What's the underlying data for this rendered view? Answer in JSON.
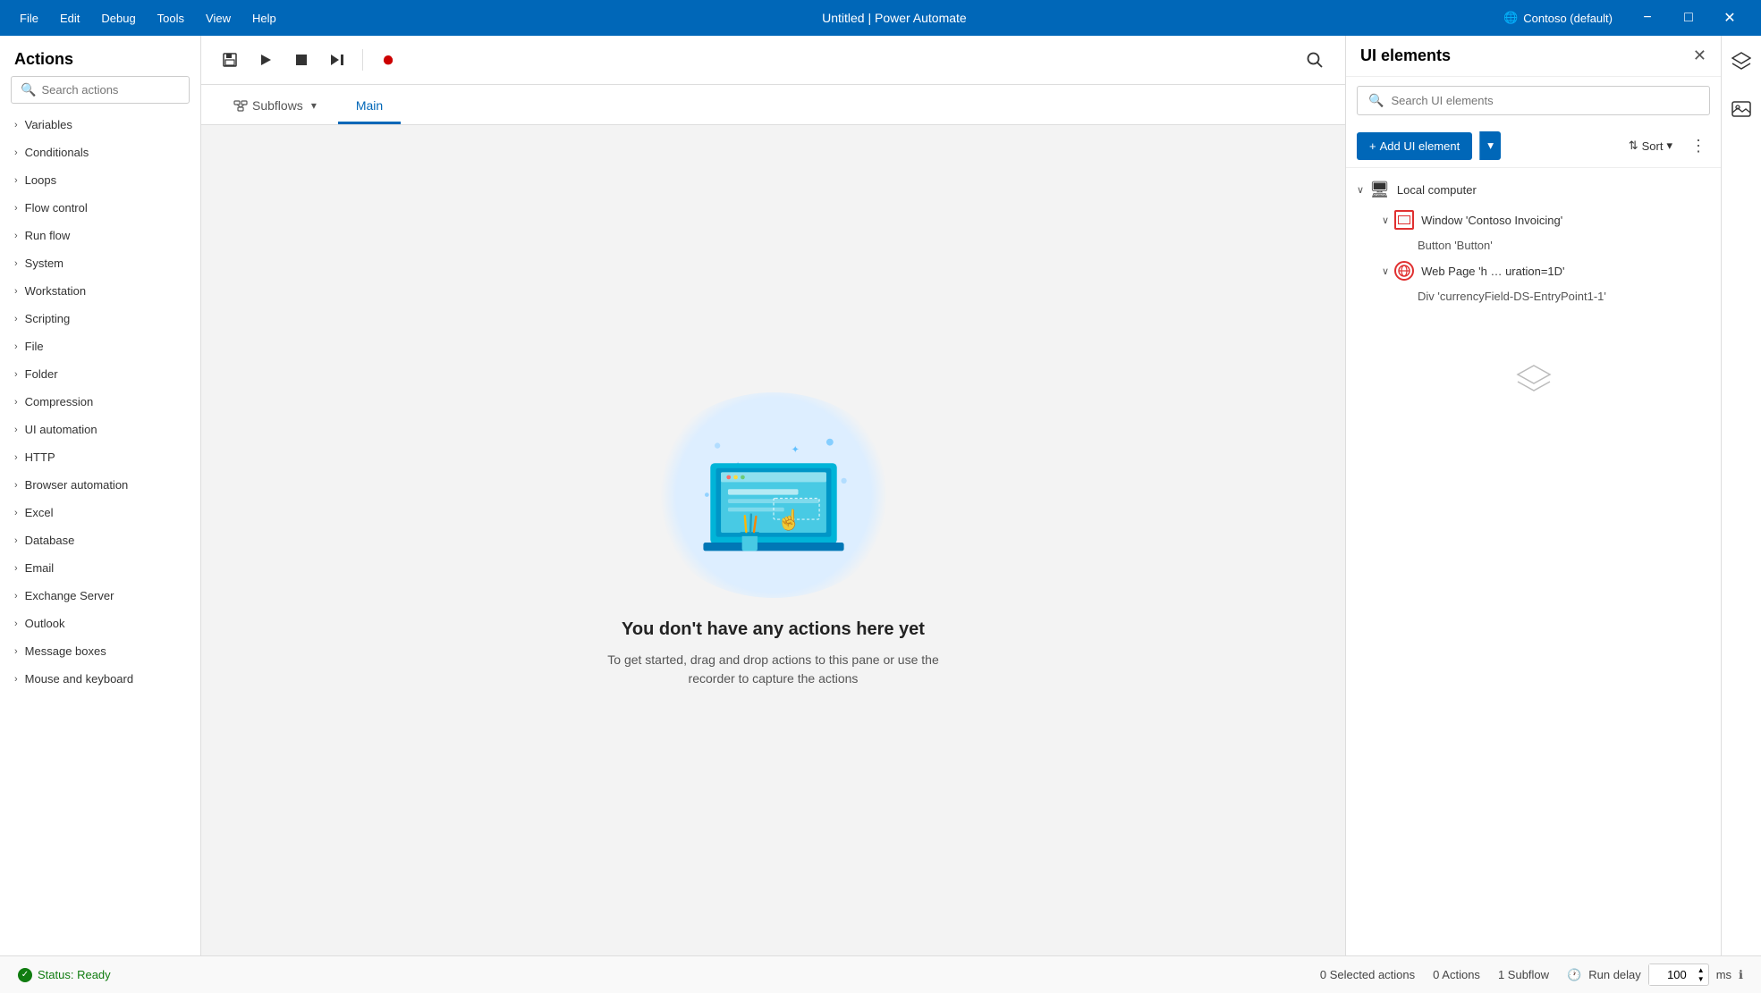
{
  "titlebar": {
    "menus": [
      "File",
      "Edit",
      "Debug",
      "Tools",
      "View",
      "Help"
    ],
    "title": "Untitled | Power Automate",
    "user": "Contoso (default)",
    "window_controls": [
      "−",
      "□",
      "✕"
    ]
  },
  "actions_panel": {
    "title": "Actions",
    "search_placeholder": "Search actions",
    "items": [
      "Variables",
      "Conditionals",
      "Loops",
      "Flow control",
      "Run flow",
      "System",
      "Workstation",
      "Scripting",
      "File",
      "Folder",
      "Compression",
      "UI automation",
      "HTTP",
      "Browser automation",
      "Excel",
      "Database",
      "Email",
      "Exchange Server",
      "Outlook",
      "Message boxes",
      "Mouse and keyboard"
    ]
  },
  "toolbar": {
    "buttons": [
      "💾",
      "▶",
      "⬛",
      "⏭"
    ],
    "record_icon": "⏺",
    "search_icon": "🔍"
  },
  "tabs": {
    "subflows_label": "Subflows",
    "main_label": "Main"
  },
  "canvas": {
    "empty_title": "You don't have any actions here yet",
    "empty_subtitle": "To get started, drag and drop actions to this pane\nor use the recorder to capture the actions"
  },
  "ui_elements_panel": {
    "title": "UI elements",
    "search_placeholder": "Search UI elements",
    "add_button_label": "Add UI element",
    "sort_label": "Sort",
    "tree": {
      "local_computer": "Local computer",
      "window_item": "Window 'Contoso Invoicing'",
      "window_child": "Button 'Button'",
      "webpage_item": "Web Page 'h … uration=1D'",
      "webpage_child": "Div 'currencyField-DS-EntryPoint1-1'"
    }
  },
  "statusbar": {
    "status": "Status: Ready",
    "selected_actions_count": "0",
    "selected_actions_label": "Selected actions",
    "actions_count": "0",
    "actions_label": "Actions",
    "subflow_count": "1",
    "subflow_label": "Subflow",
    "run_delay_label": "Run delay",
    "run_delay_value": "100",
    "run_delay_unit": "ms"
  },
  "colors": {
    "primary": "#0067b8",
    "success": "#107c10",
    "error": "#e03030",
    "tab_active": "#0067b8"
  }
}
